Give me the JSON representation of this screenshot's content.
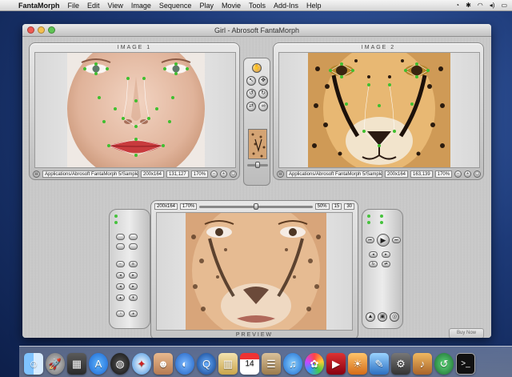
{
  "menubar": {
    "apple": "",
    "app_name": "FantaMorph",
    "items": [
      "File",
      "Edit",
      "View",
      "Image",
      "Sequence",
      "Play",
      "Movie",
      "Tools",
      "Add-Ins",
      "Help"
    ]
  },
  "window": {
    "title": "Girl - Abrosoft FantaMorph"
  },
  "image1": {
    "title": "IMAGE 1",
    "path": "Applications/Abrosoft FantaMorph 5/Samples/girl.jpg",
    "size": "200x164",
    "point": "131,127",
    "zoom": "170%"
  },
  "image2": {
    "title": "IMAGE 2",
    "path": "Applications/Abrosoft FantaMorph 5/Samples/leo.jpg",
    "size": "200x164",
    "point": "163,139",
    "zoom": "170%"
  },
  "preview": {
    "label": "PREVIEW",
    "size": "200x164",
    "zoom": "170%",
    "percent": "50%",
    "frame": "15",
    "fps": "30",
    "slider_progress": 0.5
  },
  "buy_button": "Buy Now",
  "colors": {
    "accent_green": "#46c23d",
    "desktop_blue": "#1d3a78"
  },
  "dock_icons": [
    "finder-icon",
    "launchpad-icon",
    "system-icon",
    "app-store-icon",
    "dashboard-icon",
    "safari-icon",
    "photo-booth-icon",
    "facetime-icon",
    "quicktime-icon",
    "preview-icon",
    "calendar-icon",
    "contacts-icon",
    "itunes-icon",
    "photos-icon",
    "dvd-icon",
    "iphoto-icon",
    "xcode-icon",
    "instruments-icon",
    "garageband-icon",
    "time-machine-icon",
    "terminal-icon"
  ]
}
